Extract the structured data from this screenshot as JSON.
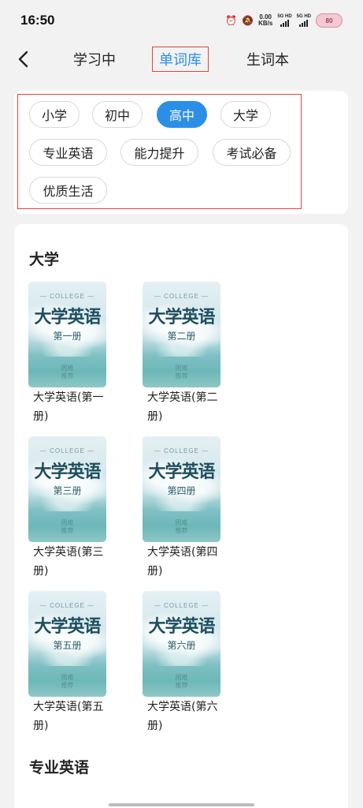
{
  "status_bar": {
    "time": "16:50",
    "net_speed": "0.00",
    "net_unit": "KB/s",
    "signal1": "5G HD",
    "signal2": "5G HD",
    "battery": "80"
  },
  "nav": {
    "tabs": [
      "学习中",
      "单词库",
      "生词本"
    ],
    "active_tab": "单词库"
  },
  "categories": {
    "items": [
      "小学",
      "初中",
      "高中",
      "大学",
      "专业英语",
      "能力提升",
      "考试必备",
      "优质生活"
    ],
    "active": "高中"
  },
  "sections": [
    {
      "title": "大学",
      "books": [
        {
          "cover_title": "大学英语",
          "cover_vol": "第一册",
          "name": "大学英语(第一册)"
        },
        {
          "cover_title": "大学英语",
          "cover_vol": "第二册",
          "name": "大学英语(第二册)"
        },
        {
          "cover_title": "大学英语",
          "cover_vol": "第三册",
          "name": "大学英语(第三册)"
        },
        {
          "cover_title": "大学英语",
          "cover_vol": "第四册",
          "name": "大学英语(第四册)"
        },
        {
          "cover_title": "大学英语",
          "cover_vol": "第五册",
          "name": "大学英语(第五册)"
        },
        {
          "cover_title": "大学英语",
          "cover_vol": "第六册",
          "name": "大学英语(第六册)"
        }
      ]
    },
    {
      "title": "专业英语",
      "books": []
    }
  ],
  "cover_common": {
    "label": "COLLEGE",
    "rec": "困难\n推荐"
  },
  "colors": {
    "accent": "#2b8fe8",
    "highlight_box": "#e0443e",
    "background": "#f2f2f2"
  }
}
